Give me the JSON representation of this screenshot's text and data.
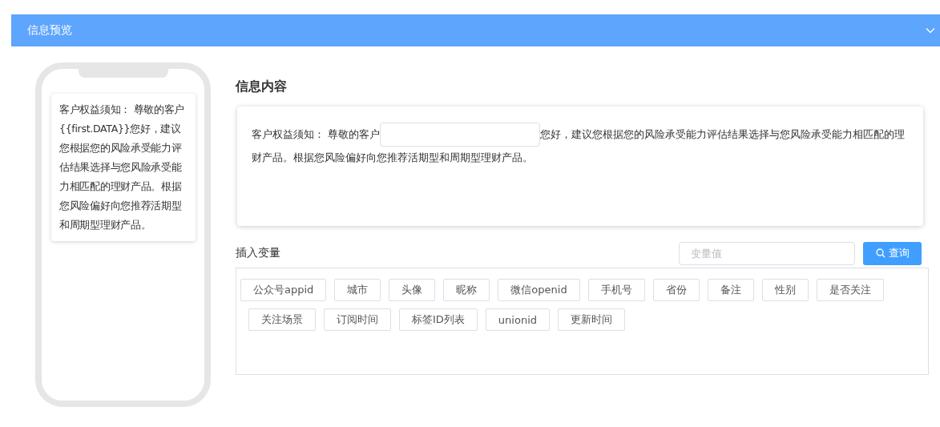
{
  "panel": {
    "title": "信息预览",
    "expanded": true
  },
  "phone_preview": {
    "text": "客户权益须知： 尊敬的客户{{first.DATA}}您好，建议您根据您的风险承受能力评估结果选择与您风险承受能力相匹配的理财产品。根据您风险偏好向您推荐活期型和周期型理财产品。"
  },
  "content": {
    "heading": "信息内容",
    "text_before": "客户权益须知： 尊敬的客户",
    "text_after": "您好，建议您根据您的风险承受能力评估结果选择与您风险承受能力相匹配的理",
    "text_next_line": "财产品。根据您风险偏好向您推荐活期型和周期型理财产品。"
  },
  "variables": {
    "heading": "插入变量",
    "search": {
      "placeholder": "变量值"
    },
    "search_button": "查询",
    "tags": [
      "公众号appid",
      "城市",
      "头像",
      "昵称",
      "微信openid",
      "手机号",
      "省份",
      "备注",
      "性别",
      "是否关注",
      "关注场景",
      "订阅时间",
      "标签ID列表",
      "unionid",
      "更新时间"
    ]
  }
}
